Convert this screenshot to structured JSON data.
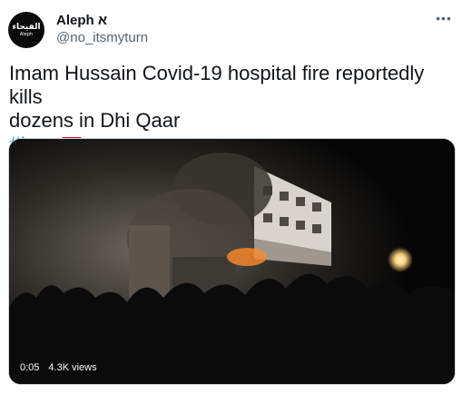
{
  "author": {
    "display_name": "Aleph א",
    "handle": "@no_itsmyturn",
    "avatar_text": "الفيحاء",
    "avatar_subtext": "Aleph"
  },
  "tweet": {
    "line1": "Imam Hussain Covid-19 hospital fire reportedly kills",
    "line2": "dozens in Dhi Qaar",
    "hashtag": "#Iraq",
    "flag_icon": "iraq-flag-icon"
  },
  "media": {
    "type": "video",
    "duration": "0:05",
    "views": "4.3K views"
  },
  "more_icon": "more-options-icon",
  "colors": {
    "link": "#1d9bf0",
    "secondary_text": "#536471",
    "primary_text": "#0f1419"
  }
}
